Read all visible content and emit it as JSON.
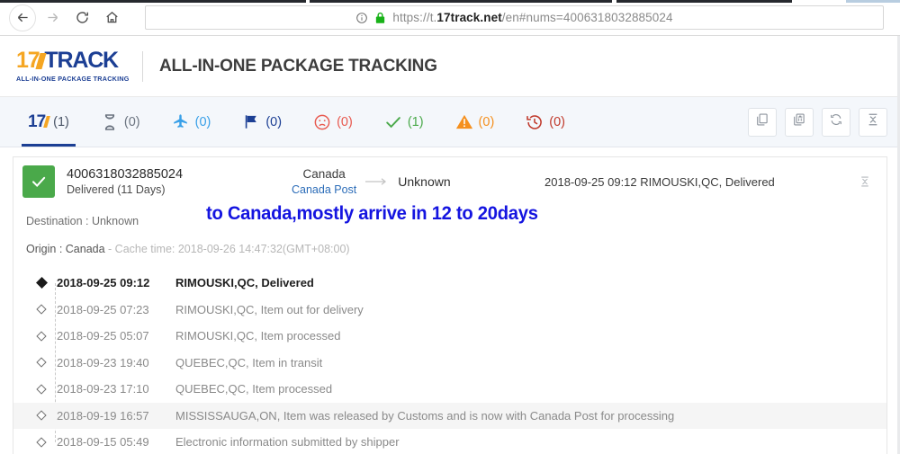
{
  "browser": {
    "back_icon": "back-arrow-icon",
    "forward_icon": "forward-arrow-icon",
    "reload_icon": "reload-icon",
    "home_icon": "home-icon",
    "info_icon": "page-info-icon",
    "lock_icon": "lock-icon",
    "url_scheme": "https://t.",
    "url_domain": "17track.net",
    "url_path": "/en#nums=4006318032885024",
    "url_full": "https://t.17track.net/en#nums=4006318032885024"
  },
  "site": {
    "logo_17": "17",
    "logo_track": "TRACK",
    "logo_sub": "ALL-IN-ONE PACKAGE TRACKING",
    "tagline": "ALL-IN-ONE PACKAGE TRACKING"
  },
  "tabs": [
    {
      "name": "all",
      "icon": "17-logo-icon",
      "label": "17",
      "count": "(1)",
      "color": "#1c3f94",
      "active": true
    },
    {
      "name": "not-found",
      "icon": "hourglass-icon",
      "label": "",
      "count": "(0)",
      "color": "#6b7480",
      "active": false
    },
    {
      "name": "in-transit",
      "icon": "airplane-icon",
      "label": "",
      "count": "(0)",
      "color": "#39a0e8",
      "active": false
    },
    {
      "name": "pickup",
      "icon": "flag-icon",
      "label": "",
      "count": "(0)",
      "color": "#1c3f94",
      "active": false
    },
    {
      "name": "undelivered",
      "icon": "sad-face-icon",
      "label": "",
      "count": "(0)",
      "color": "#e8594f",
      "active": false
    },
    {
      "name": "delivered",
      "icon": "check-icon",
      "label": "",
      "count": "(1)",
      "color": "#4aa94a",
      "active": false
    },
    {
      "name": "alert",
      "icon": "warning-icon",
      "label": "",
      "count": "(0)",
      "color": "#f5901e",
      "active": false
    },
    {
      "name": "expired",
      "icon": "clock-history-icon",
      "label": "",
      "count": "(0)",
      "color": "#c0392b",
      "active": false
    }
  ],
  "toolbar": [
    {
      "name": "copy-button",
      "icon": "copy-icon"
    },
    {
      "name": "delete-button",
      "icon": "copy-trash-icon"
    },
    {
      "name": "refresh-button",
      "icon": "refresh-icon"
    },
    {
      "name": "collapse-button",
      "icon": "collapse-icon"
    }
  ],
  "result": {
    "status_icon": "check-icon",
    "tracking_number": "4006318032885024",
    "status_text": "Delivered (11 Days)",
    "origin_country": "Canada",
    "carrier": "Canada Post",
    "arrow_icon": "arrow-right-icon",
    "destination_country": "Unknown",
    "last_event": "2018-09-25 09:12  RIMOUSKI,QC, Delivered",
    "collapse_icon": "collapse-icon",
    "destination_label": "Destination : Unknown",
    "origin_label": "Origin : Canada",
    "cache_time": "- Cache time: 2018-09-26 14:47:32(GMT+08:00)",
    "annotation": "to Canada,mostly arrive in 12 to 20days",
    "annotation_color": "#1414e0"
  },
  "timeline": [
    {
      "date": "2018-09-25 09:12",
      "desc": "RIMOUSKI,QC, Delivered",
      "first": true,
      "highlight": false
    },
    {
      "date": "2018-09-25 07:23",
      "desc": "RIMOUSKI,QC, Item out for delivery",
      "first": false,
      "highlight": false
    },
    {
      "date": "2018-09-25 05:07",
      "desc": "RIMOUSKI,QC, Item processed",
      "first": false,
      "highlight": false
    },
    {
      "date": "2018-09-23 19:40",
      "desc": "QUEBEC,QC, Item in transit",
      "first": false,
      "highlight": false
    },
    {
      "date": "2018-09-23 17:10",
      "desc": "QUEBEC,QC, Item processed",
      "first": false,
      "highlight": false
    },
    {
      "date": "2018-09-19 16:57",
      "desc": "MISSISSAUGA,ON, Item was released by Customs and is now with Canada Post for processing",
      "first": false,
      "highlight": true
    },
    {
      "date": "2018-09-15 05:49",
      "desc": "Electronic information submitted by shipper",
      "first": false,
      "highlight": false
    }
  ]
}
